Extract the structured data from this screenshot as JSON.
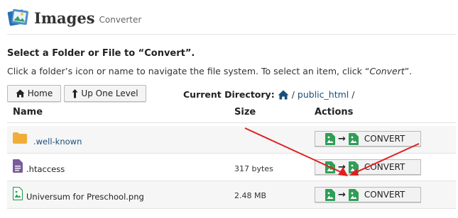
{
  "app": {
    "title": "Images",
    "subtitle": "Converter"
  },
  "section_title": "Select a Folder or File to “Convert”.",
  "instructions": {
    "pre": "Click a folder’s icon or name to navigate the file system. To select an item, click “",
    "em": "Convert",
    "post": "”."
  },
  "nav": {
    "home_label": "Home",
    "up_label": "Up One Level"
  },
  "current_directory": {
    "label": "Current Directory:",
    "path": "public_html",
    "sep": "/",
    "trail": "/"
  },
  "table": {
    "headers": {
      "name": "Name",
      "size": "Size",
      "actions": "Actions"
    },
    "rows": [
      {
        "name": "./.well-known",
        "display": ".well-known",
        "type": "folder",
        "size": "",
        "action": "CONVERT"
      },
      {
        "name": ".htaccess",
        "display": ".htaccess",
        "type": "file",
        "size": "317 bytes",
        "action": "CONVERT"
      },
      {
        "name": "Universum for Preschool.png",
        "display": "Universum for Preschool.png",
        "type": "image",
        "size": "2.48 MB",
        "action": "CONVERT"
      }
    ]
  },
  "colors": {
    "folder": "#f0ad3a",
    "file": "#7a5b9c",
    "image": "#2f9e57",
    "annotation": "#e02020",
    "link": "#1a4e7a"
  }
}
